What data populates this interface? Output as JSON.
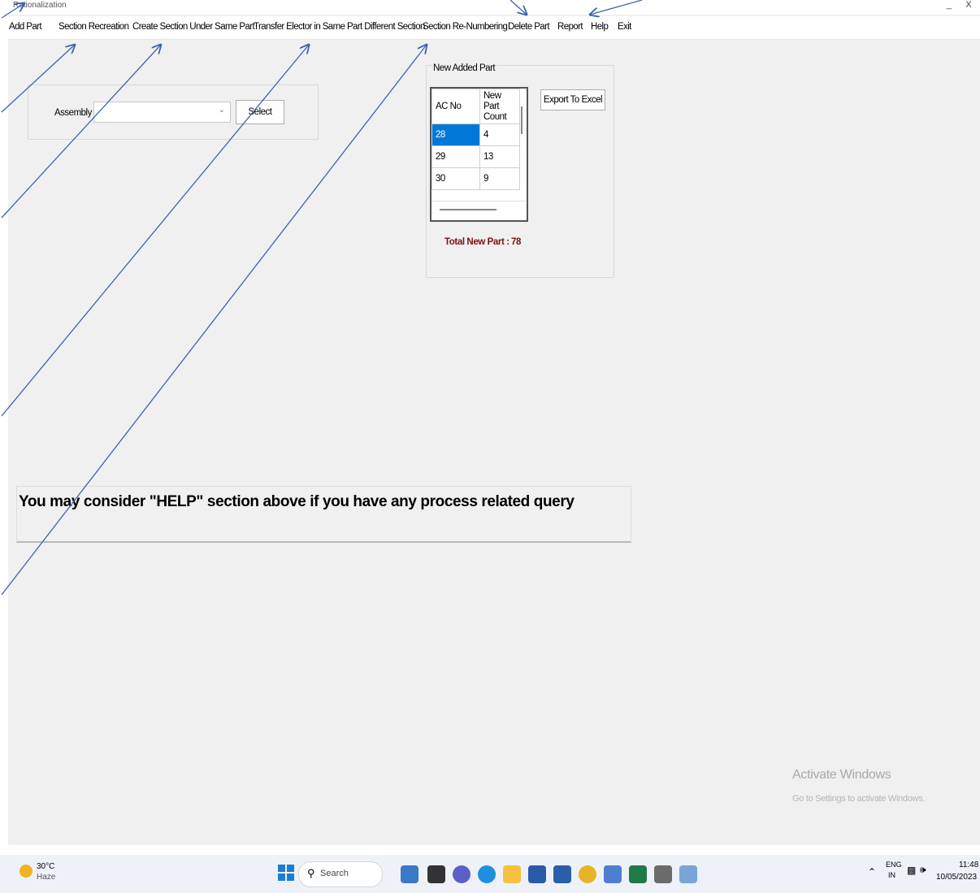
{
  "window": {
    "title": "Rationalization",
    "minimize": "_",
    "close": "X"
  },
  "menu": {
    "items": [
      "Add Part",
      "Section Recreation",
      "Create Section Under Same Part",
      "Transfer Elector in Same Part Different Section",
      "Section Re-Numbering",
      "Delete Part",
      "Report",
      "Help",
      "Exit"
    ]
  },
  "assembly": {
    "label": "Assembly",
    "value": "",
    "select_label": "Select"
  },
  "new_parts": {
    "group_title": "New Added Part",
    "headers": [
      "AC No",
      "New Part Count"
    ],
    "rows": [
      [
        "28",
        "4"
      ],
      [
        "29",
        "13"
      ],
      [
        "30",
        "9"
      ]
    ],
    "export_label": "Export To Excel",
    "total_label": "Total New Part :",
    "total_value": "78"
  },
  "help_note": "You may consider \"HELP\" section above if you have any process related query",
  "watermark": {
    "line1": "Activate Windows",
    "line2": "Go to Settings to activate Windows."
  },
  "taskbar": {
    "weather_temp": "30°C",
    "weather_desc": "Haze",
    "search_label": "Search",
    "lang": "ENG",
    "region": "IN",
    "time": "11:48",
    "date": "10/05/2023"
  },
  "colors": {
    "selection": "#0078d7",
    "total_text": "#7a1010",
    "annotation_arrow": "#3b64ad"
  }
}
